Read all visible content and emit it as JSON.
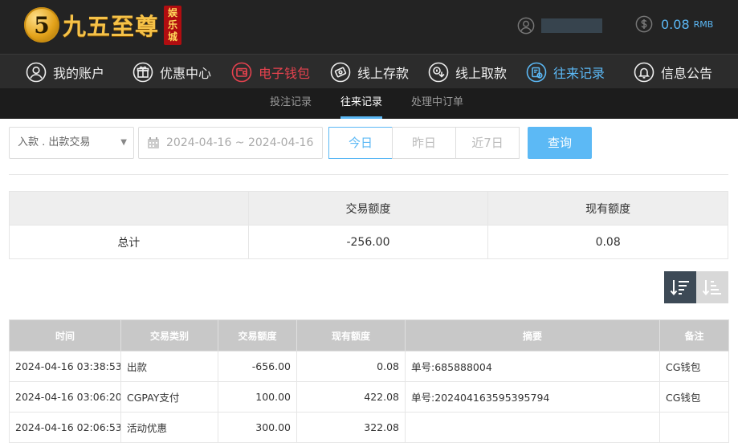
{
  "brand": {
    "logo_char": "5",
    "name": "九五至尊",
    "badge": "娱乐城"
  },
  "user": {
    "username": "********",
    "balance": "0.08",
    "currency": "RMB"
  },
  "main_nav": [
    {
      "label": "我的账户",
      "icon": "user-circle-icon"
    },
    {
      "label": "优惠中心",
      "icon": "gift-icon"
    },
    {
      "label": "电子钱包",
      "icon": "wallet-icon"
    },
    {
      "label": "线上存款",
      "icon": "deposit-icon"
    },
    {
      "label": "线上取款",
      "icon": "withdraw-icon"
    },
    {
      "label": "往来记录",
      "icon": "records-icon"
    },
    {
      "label": "信息公告",
      "icon": "bell-icon"
    }
  ],
  "sub_nav": [
    {
      "label": "投注记录"
    },
    {
      "label": "往来记录"
    },
    {
      "label": "处理中订单"
    }
  ],
  "filters": {
    "type_select": "入款 . 出款交易",
    "date_range": "2024-04-16 ~ 2024-04-16",
    "quick_ranges": [
      "今日",
      "昨日",
      "近7日"
    ],
    "query_label": "查询"
  },
  "summary": {
    "headers": [
      "",
      "交易额度",
      "现有额度"
    ],
    "row": [
      "总计",
      "-256.00",
      "0.08"
    ]
  },
  "records": {
    "headers": [
      "时间",
      "交易类别",
      "交易额度",
      "现有额度",
      "摘要",
      "备注"
    ],
    "rows": [
      [
        "2024-04-16 03:38:53",
        "出款",
        "-656.00",
        "0.08",
        "单号:685888004",
        "CG钱包"
      ],
      [
        "2024-04-16 03:06:20",
        "CGPAY支付",
        "100.00",
        "422.08",
        "单号:202404163595395794",
        "CG钱包"
      ],
      [
        "2024-04-16 02:06:53",
        "活动优惠",
        "300.00",
        "322.08",
        "",
        ""
      ]
    ]
  },
  "colors": {
    "accent_blue": "#5bb8f5",
    "wallet_red": "#e5424e",
    "header_bg": "#232323"
  }
}
